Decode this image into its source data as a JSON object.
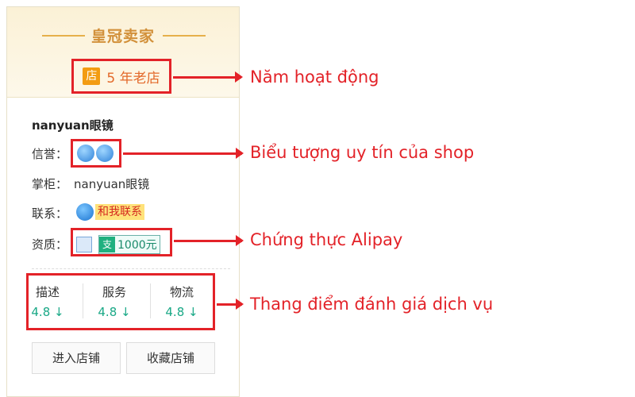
{
  "header": {
    "title": "皇冠卖家"
  },
  "shop_age": {
    "badge": "店",
    "text": "5 年老店"
  },
  "shop_name": "nanyuan眼镜",
  "credit": {
    "label": "信誉："
  },
  "keeper": {
    "label": "掌柜：",
    "value": "nanyuan眼镜"
  },
  "contact": {
    "label": "联系：",
    "button": "和我联系"
  },
  "qualification": {
    "label": "资质：",
    "alipay_amount": "1000元"
  },
  "ratings": [
    {
      "name": "描述",
      "value": "4.8 ↓"
    },
    {
      "name": "服务",
      "value": "4.8 ↓"
    },
    {
      "name": "物流",
      "value": "4.8 ↓"
    }
  ],
  "buttons": {
    "enter_shop": "进入店铺",
    "favorite_shop": "收藏店铺"
  },
  "annotations": {
    "years": "Năm hoạt động",
    "credit_icon": "Biểu tượng uy tín của shop",
    "alipay": "Chứng thực Alipay",
    "rating": "Thang điểm đánh giá dịch vụ"
  },
  "colors": {
    "annotation_red": "#e32228",
    "title_orange": "#d2903a",
    "rating_green": "#19a886"
  }
}
